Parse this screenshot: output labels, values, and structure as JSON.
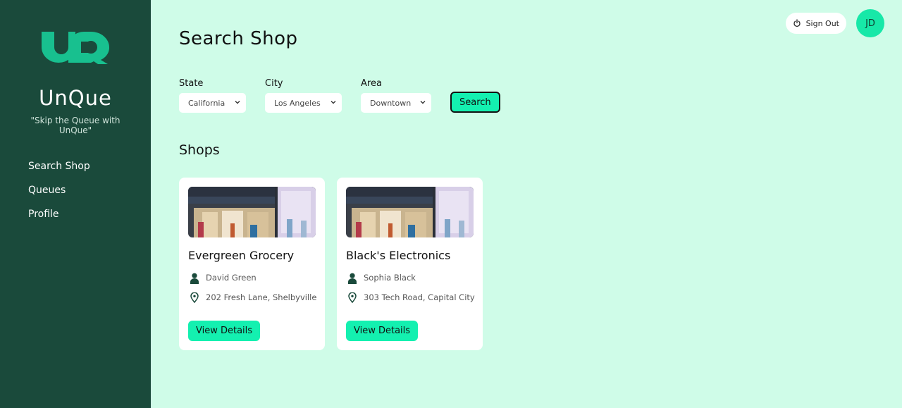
{
  "app": {
    "name": "UnQue",
    "tagline": "\"Skip the Queue with UnQue\""
  },
  "sidebar": {
    "items": [
      {
        "label": "Search Shop"
      },
      {
        "label": "Queues"
      },
      {
        "label": "Profile"
      }
    ]
  },
  "header": {
    "signout_label": "Sign Out",
    "avatar_initials": "JD"
  },
  "main": {
    "title": "Search Shop",
    "filters": {
      "state": {
        "label": "State",
        "value": "California"
      },
      "city": {
        "label": "City",
        "value": "Los Angeles"
      },
      "area": {
        "label": "Area",
        "value": "Downtown"
      },
      "search_label": "Search"
    },
    "shops_title": "Shops",
    "shops": [
      {
        "name": "Evergreen Grocery",
        "owner": "David Green",
        "address": "202 Fresh Lane, Shelbyville",
        "button": "View Details"
      },
      {
        "name": "Black's Electronics",
        "owner": "Sophia Black",
        "address": "303 Tech Road, Capital City",
        "button": "View Details"
      }
    ]
  },
  "colors": {
    "sidebar_bg": "#1a4a3b",
    "page_bg": "#cffce8",
    "accent": "#14f0b0"
  },
  "icons": {
    "signout": "power-icon",
    "owner": "person-icon",
    "address": "location-pin-icon",
    "select": "chevron-down-icon"
  }
}
